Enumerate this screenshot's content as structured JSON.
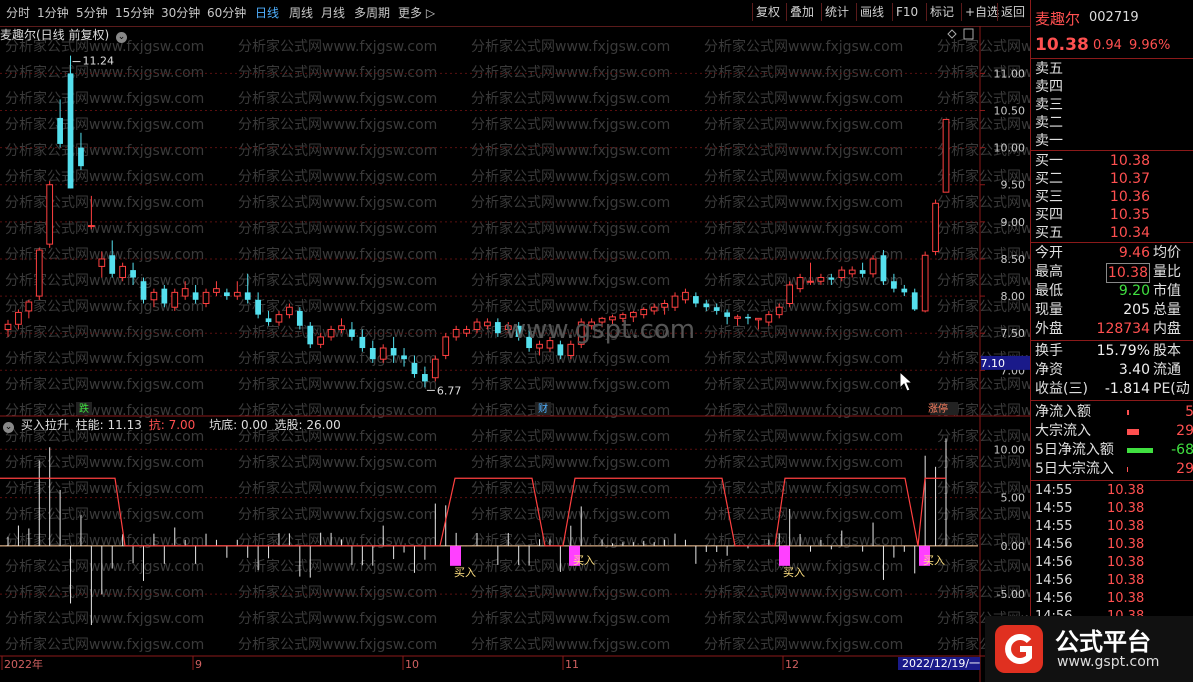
{
  "toolbar": {
    "periods": [
      "分时",
      "1分钟",
      "5分钟",
      "15分钟",
      "30分钟",
      "60分钟",
      "日线",
      "周线",
      "月线",
      "多周期",
      "更多 ▷"
    ],
    "active_period": "日线",
    "right_buttons": [
      "复权",
      "叠加",
      "统计",
      "画线",
      "F10",
      "标记",
      "+自选",
      "返回"
    ]
  },
  "main_chart": {
    "title": "麦趣尔(日线 前复权)",
    "high_annotation": "11.24",
    "low_annotation": "6.77",
    "price_box": "7.10",
    "event_labels": [
      "跌",
      "财",
      "涨停"
    ],
    "watermark_mid": "www.gspt.com",
    "watermark_text": "分析家公式网www.fxjgsw.com"
  },
  "chart_data": {
    "type": "candlestick",
    "y_axis_ticks": [
      11.0,
      10.5,
      10.0,
      9.5,
      9.0,
      8.5,
      8.0,
      7.5,
      7.0
    ],
    "ylim": [
      6.6,
      11.45
    ],
    "candles": [
      [
        7.55,
        7.68,
        7.45,
        7.62
      ],
      [
        7.62,
        7.82,
        7.55,
        7.78
      ],
      [
        7.8,
        7.95,
        7.7,
        7.92
      ],
      [
        8.0,
        8.65,
        7.95,
        8.62
      ],
      [
        8.7,
        9.55,
        8.65,
        9.5
      ],
      [
        10.4,
        10.65,
        10.0,
        10.05
      ],
      [
        11.0,
        11.24,
        9.45,
        9.45
      ],
      [
        10.0,
        10.2,
        9.7,
        9.75
      ],
      [
        8.95,
        9.35,
        8.9,
        8.95
      ],
      [
        8.4,
        8.6,
        8.25,
        8.5
      ],
      [
        8.55,
        8.75,
        8.25,
        8.3
      ],
      [
        8.25,
        8.45,
        8.2,
        8.4
      ],
      [
        8.35,
        8.45,
        8.15,
        8.25
      ],
      [
        8.2,
        8.25,
        7.9,
        7.95
      ],
      [
        7.95,
        8.1,
        7.85,
        8.05
      ],
      [
        8.1,
        8.15,
        7.85,
        7.9
      ],
      [
        7.85,
        8.1,
        7.8,
        8.05
      ],
      [
        8.0,
        8.2,
        7.95,
        8.1
      ],
      [
        8.05,
        8.15,
        7.9,
        7.95
      ],
      [
        7.9,
        8.1,
        7.85,
        8.05
      ],
      [
        8.05,
        8.2,
        8.0,
        8.1
      ],
      [
        8.05,
        8.1,
        7.95,
        8.0
      ],
      [
        8.0,
        8.2,
        7.95,
        8.05
      ],
      [
        8.05,
        8.3,
        7.9,
        7.95
      ],
      [
        7.95,
        8.05,
        7.7,
        7.75
      ],
      [
        7.7,
        7.8,
        7.6,
        7.65
      ],
      [
        7.65,
        7.8,
        7.6,
        7.75
      ],
      [
        7.75,
        7.9,
        7.7,
        7.85
      ],
      [
        7.8,
        7.85,
        7.55,
        7.6
      ],
      [
        7.6,
        7.65,
        7.3,
        7.35
      ],
      [
        7.35,
        7.5,
        7.3,
        7.45
      ],
      [
        7.45,
        7.6,
        7.4,
        7.55
      ],
      [
        7.55,
        7.7,
        7.5,
        7.6
      ],
      [
        7.55,
        7.65,
        7.4,
        7.45
      ],
      [
        7.45,
        7.55,
        7.25,
        7.3
      ],
      [
        7.3,
        7.4,
        7.1,
        7.15
      ],
      [
        7.15,
        7.35,
        7.1,
        7.3
      ],
      [
        7.3,
        7.45,
        7.1,
        7.2
      ],
      [
        7.2,
        7.3,
        7.05,
        7.15
      ],
      [
        7.1,
        7.2,
        6.9,
        6.95
      ],
      [
        6.95,
        7.05,
        6.77,
        6.85
      ],
      [
        6.9,
        7.2,
        6.85,
        7.15
      ],
      [
        7.2,
        7.5,
        7.15,
        7.45
      ],
      [
        7.45,
        7.6,
        7.4,
        7.55
      ],
      [
        7.5,
        7.6,
        7.45,
        7.55
      ],
      [
        7.55,
        7.7,
        7.5,
        7.65
      ],
      [
        7.6,
        7.7,
        7.55,
        7.65
      ],
      [
        7.65,
        7.7,
        7.45,
        7.5
      ],
      [
        7.55,
        7.65,
        7.5,
        7.6
      ],
      [
        7.6,
        7.65,
        7.4,
        7.45
      ],
      [
        7.45,
        7.55,
        7.25,
        7.3
      ],
      [
        7.3,
        7.4,
        7.2,
        7.35
      ],
      [
        7.3,
        7.45,
        7.25,
        7.4
      ],
      [
        7.35,
        7.4,
        7.15,
        7.2
      ],
      [
        7.2,
        7.4,
        7.15,
        7.35
      ],
      [
        7.35,
        7.7,
        7.3,
        7.65
      ],
      [
        7.6,
        7.7,
        7.55,
        7.65
      ],
      [
        7.65,
        7.72,
        7.58,
        7.7
      ],
      [
        7.68,
        7.75,
        7.6,
        7.72
      ],
      [
        7.7,
        7.78,
        7.65,
        7.75
      ],
      [
        7.72,
        7.8,
        7.65,
        7.78
      ],
      [
        7.75,
        7.85,
        7.7,
        7.82
      ],
      [
        7.8,
        7.9,
        7.75,
        7.85
      ],
      [
        7.85,
        7.95,
        7.75,
        7.9
      ],
      [
        7.85,
        8.05,
        7.8,
        8.0
      ],
      [
        7.95,
        8.1,
        7.9,
        8.05
      ],
      [
        8.0,
        8.05,
        7.85,
        7.9
      ],
      [
        7.9,
        7.95,
        7.8,
        7.85
      ],
      [
        7.85,
        7.9,
        7.75,
        7.8
      ],
      [
        7.78,
        7.82,
        7.62,
        7.72
      ],
      [
        7.7,
        7.75,
        7.6,
        7.72
      ],
      [
        7.72,
        7.76,
        7.62,
        7.7
      ],
      [
        7.68,
        7.7,
        7.55,
        7.7
      ],
      [
        7.65,
        7.8,
        7.6,
        7.75
      ],
      [
        7.75,
        7.9,
        7.7,
        7.85
      ],
      [
        7.9,
        8.2,
        7.85,
        8.15
      ],
      [
        8.1,
        8.3,
        8.05,
        8.25
      ],
      [
        8.2,
        8.45,
        8.15,
        8.2
      ],
      [
        8.2,
        8.3,
        8.15,
        8.25
      ],
      [
        8.25,
        8.3,
        8.15,
        8.22
      ],
      [
        8.25,
        8.4,
        8.2,
        8.35
      ],
      [
        8.3,
        8.4,
        8.25,
        8.35
      ],
      [
        8.35,
        8.45,
        8.25,
        8.3
      ],
      [
        8.3,
        8.55,
        8.25,
        8.5
      ],
      [
        8.55,
        8.62,
        8.15,
        8.2
      ],
      [
        8.2,
        8.3,
        8.05,
        8.1
      ],
      [
        8.1,
        8.15,
        8.0,
        8.05
      ],
      [
        8.05,
        8.1,
        7.8,
        7.82
      ],
      [
        7.8,
        8.6,
        7.78,
        8.55
      ],
      [
        8.6,
        9.3,
        8.55,
        9.25
      ],
      [
        9.4,
        10.38,
        9.4,
        10.38
      ]
    ],
    "indicator": {
      "name": "买入拉升",
      "labels": {
        "zhuneng": "柱能: 11.13",
        "kang": "抗: 7.00",
        "kangdi": "坑底: 0.00",
        "xuangu": "选股: 26.00"
      },
      "y_axis_ticks": [
        10.0,
        5.0,
        0.0,
        -5.0
      ],
      "ylim": [
        -11.0,
        12.0
      ],
      "buy_label": "买入"
    },
    "x_axis_labels": [
      "2022年",
      "9",
      "10",
      "11",
      "12",
      "2022/12/19/一"
    ]
  },
  "right_panel": {
    "name": "麦趣尔",
    "code": "002719",
    "price": "10.38",
    "change": "0.94",
    "change_pct": "9.96%",
    "asks": [
      {
        "label": "卖五",
        "val": ""
      },
      {
        "label": "卖四",
        "val": ""
      },
      {
        "label": "卖三",
        "val": ""
      },
      {
        "label": "卖二",
        "val": ""
      },
      {
        "label": "卖一",
        "val": ""
      }
    ],
    "bids": [
      {
        "label": "买一",
        "val": "10.38"
      },
      {
        "label": "买二",
        "val": "10.37"
      },
      {
        "label": "买三",
        "val": "10.36"
      },
      {
        "label": "买四",
        "val": "10.35"
      },
      {
        "label": "买五",
        "val": "10.34"
      }
    ],
    "stats": [
      {
        "l": "今开",
        "v": "9.46",
        "c": "red",
        "r": "均价"
      },
      {
        "l": "最高",
        "v": "10.38",
        "c": "red",
        "r": "量比"
      },
      {
        "l": "最低",
        "v": "9.20",
        "c": "green",
        "r": "市值"
      },
      {
        "l": "现量",
        "v": "205",
        "c": "white",
        "r": "总量"
      },
      {
        "l": "外盘",
        "v": "128734",
        "c": "red",
        "r": "内盘"
      }
    ],
    "stats2": [
      {
        "l": "换手",
        "v": "15.79%",
        "c": "white",
        "r": "股本"
      },
      {
        "l": "净资",
        "v": "3.40",
        "c": "white",
        "r": "流通"
      },
      {
        "l": "收益(三)",
        "v": "-1.814",
        "c": "white",
        "r": "PE(动"
      }
    ],
    "flows": [
      {
        "l": "净流入额",
        "v": "5"
      },
      {
        "l": "大宗流入",
        "v": "29"
      },
      {
        "l": "5日净流入额",
        "v": "-68"
      },
      {
        "l": "5日大宗流入",
        "v": "29"
      }
    ],
    "ticks": [
      {
        "t": "14:55",
        "p": "10.38"
      },
      {
        "t": "14:55",
        "p": "10.38"
      },
      {
        "t": "14:55",
        "p": "10.38"
      },
      {
        "t": "14:56",
        "p": "10.38"
      },
      {
        "t": "14:56",
        "p": "10.38"
      },
      {
        "t": "14:56",
        "p": "10.38"
      },
      {
        "t": "14:56",
        "p": "10.38"
      },
      {
        "t": "14:56",
        "p": "10.38"
      }
    ]
  },
  "logo": {
    "text": "公式平台",
    "url": "www.gspt.com"
  },
  "colors": {
    "up": "#ff4040",
    "down": "#55e0ee",
    "grid": "#5a1010",
    "axis": "#8b1a1a",
    "buy": "#ff40ff"
  }
}
